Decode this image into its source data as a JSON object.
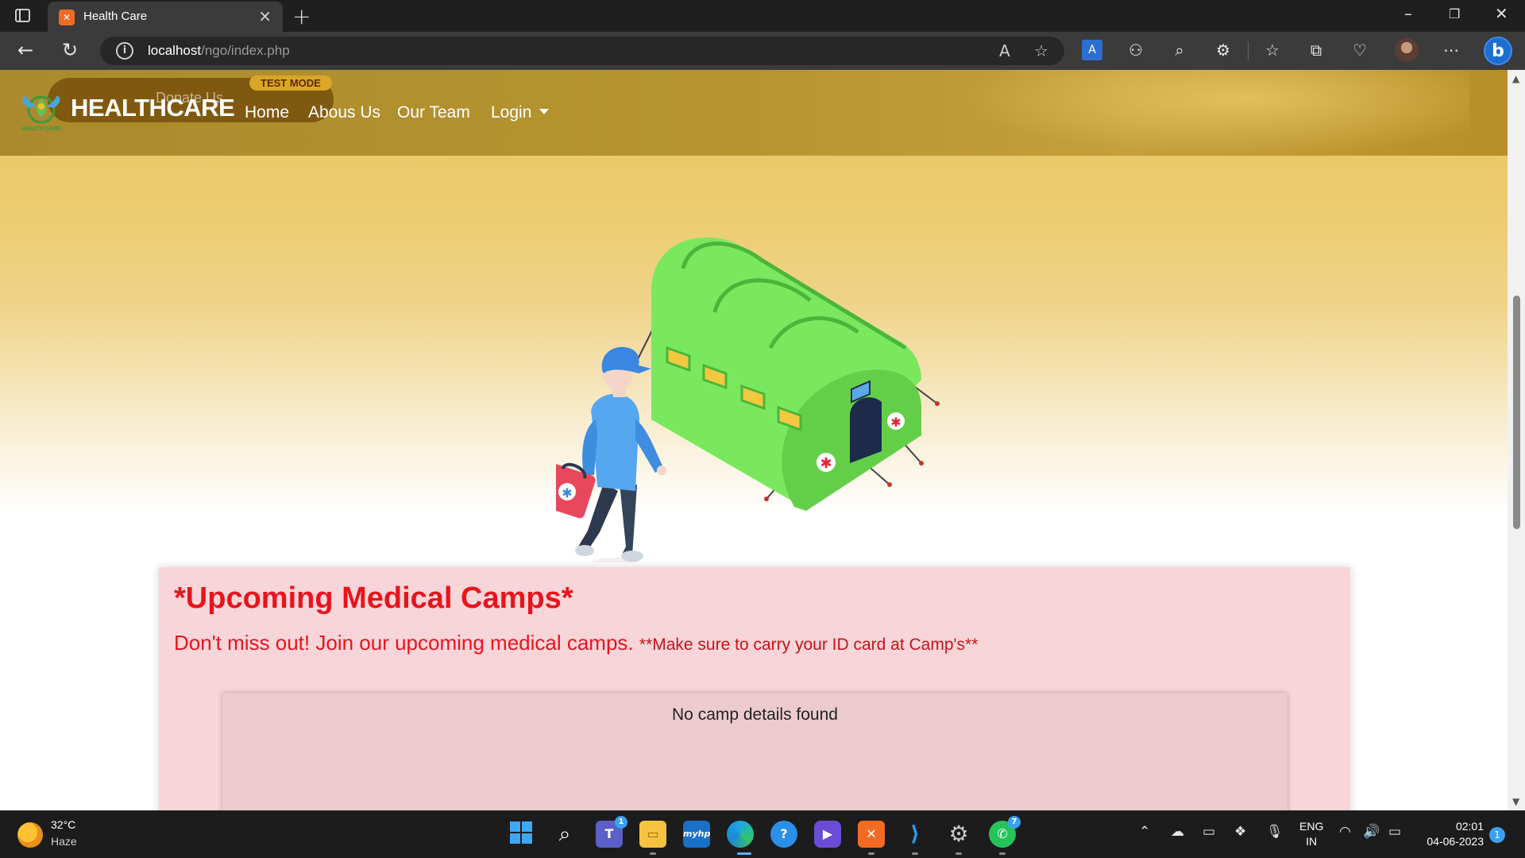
{
  "browser": {
    "tab": {
      "title": "Health Care",
      "favicon": "xampp-icon"
    },
    "url": {
      "host": "localhost",
      "path": "/ngo/index.php"
    }
  },
  "site": {
    "ribbon": {
      "donate": "Donate Us",
      "test_mode": "TEST MODE"
    },
    "logo_text": "HEALTH CARE",
    "brand": "HEALTHCARE",
    "nav": [
      {
        "label": "Home"
      },
      {
        "label": "Abous Us"
      },
      {
        "label": "Our Team"
      },
      {
        "label": "Login"
      }
    ],
    "camps": {
      "title": "*Upcoming Medical Camps*",
      "subtitle": "Don't miss out! Join our upcoming medical camps.",
      "note": "**Make sure to carry your ID card at Camp's**",
      "empty": "No camp details found"
    },
    "colors": {
      "navbar": "#b8952f",
      "camps_bg": "#f8d5d9",
      "camps_title": "#e8141c",
      "tent": "#7ae05a"
    }
  },
  "taskbar": {
    "weather": {
      "temp": "32°C",
      "desc": "Haze"
    },
    "apps": [
      {
        "name": "start-icon"
      },
      {
        "name": "search-icon"
      },
      {
        "name": "teams-icon",
        "badge": "1"
      },
      {
        "name": "file-explorer-icon"
      },
      {
        "name": "myhp-icon",
        "label": "myhp"
      },
      {
        "name": "edge-icon"
      },
      {
        "name": "help-icon"
      },
      {
        "name": "copilot-icon"
      },
      {
        "name": "xampp-icon"
      },
      {
        "name": "vscode-icon"
      },
      {
        "name": "settings-icon"
      },
      {
        "name": "whatsapp-icon",
        "badge": "7"
      }
    ],
    "tray": {
      "lang_line1": "ENG",
      "lang_line2": "IN",
      "time": "02:01",
      "date": "04-06-2023",
      "notifications": "1"
    }
  }
}
